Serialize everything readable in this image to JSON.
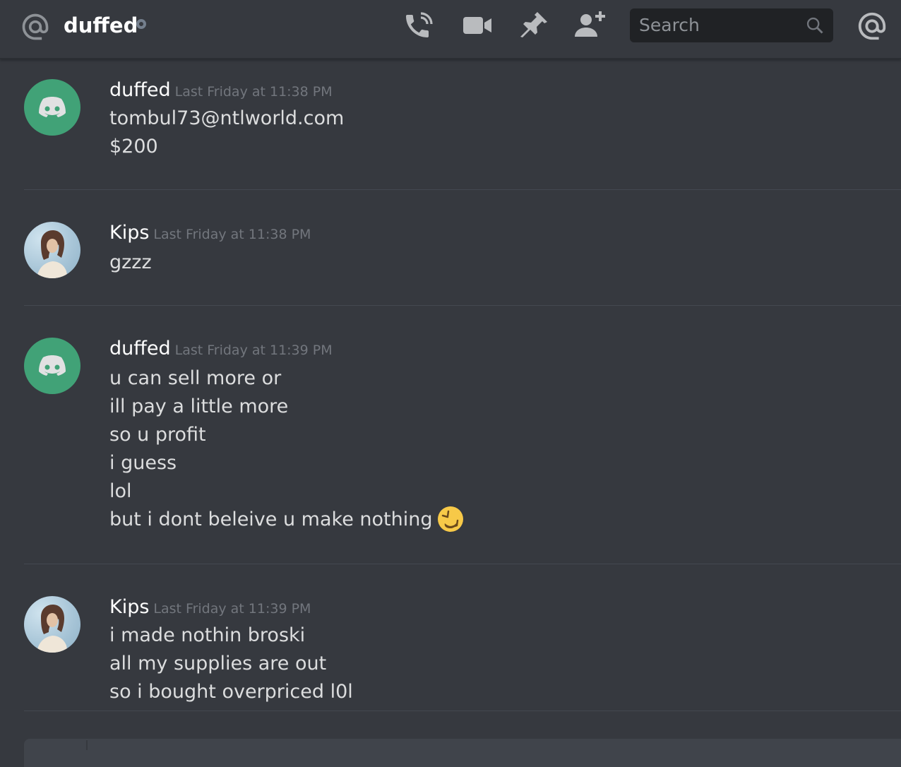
{
  "header": {
    "channel_name": "duffed",
    "search_placeholder": "Search",
    "icons": [
      "at-icon",
      "call-icon",
      "video-icon",
      "pin-icon",
      "add-friend-icon",
      "search-icon",
      "mention-icon"
    ]
  },
  "messages": [
    {
      "author": "duffed",
      "timestamp": "Last Friday at 11:38 PM",
      "avatar": "discord-default-avatar",
      "lines": [
        "tombul73@ntlworld.com",
        "$200"
      ]
    },
    {
      "author": "Kips",
      "timestamp": "Last Friday at 11:38 PM",
      "avatar": "photo-avatar",
      "lines": [
        "gzzz"
      ]
    },
    {
      "author": "duffed",
      "timestamp": "Last Friday at 11:39 PM",
      "avatar": "discord-default-avatar",
      "lines": [
        "u can sell more or",
        "ill pay a little more",
        "so u profit",
        "i guess",
        "lol",
        "but i dont beleive u make nothing"
      ],
      "emoji": "rolling-on-floor-laughing-emoji"
    },
    {
      "author": "Kips",
      "timestamp": "Last Friday at 11:39 PM",
      "avatar": "photo-avatar",
      "lines": [
        "i made nothin broski",
        "all my supplies are out",
        "so i bought overpriced l0l"
      ]
    }
  ],
  "colors": {
    "background": "#36393f",
    "discord_green": "#43b581",
    "search_bg": "#202225"
  }
}
